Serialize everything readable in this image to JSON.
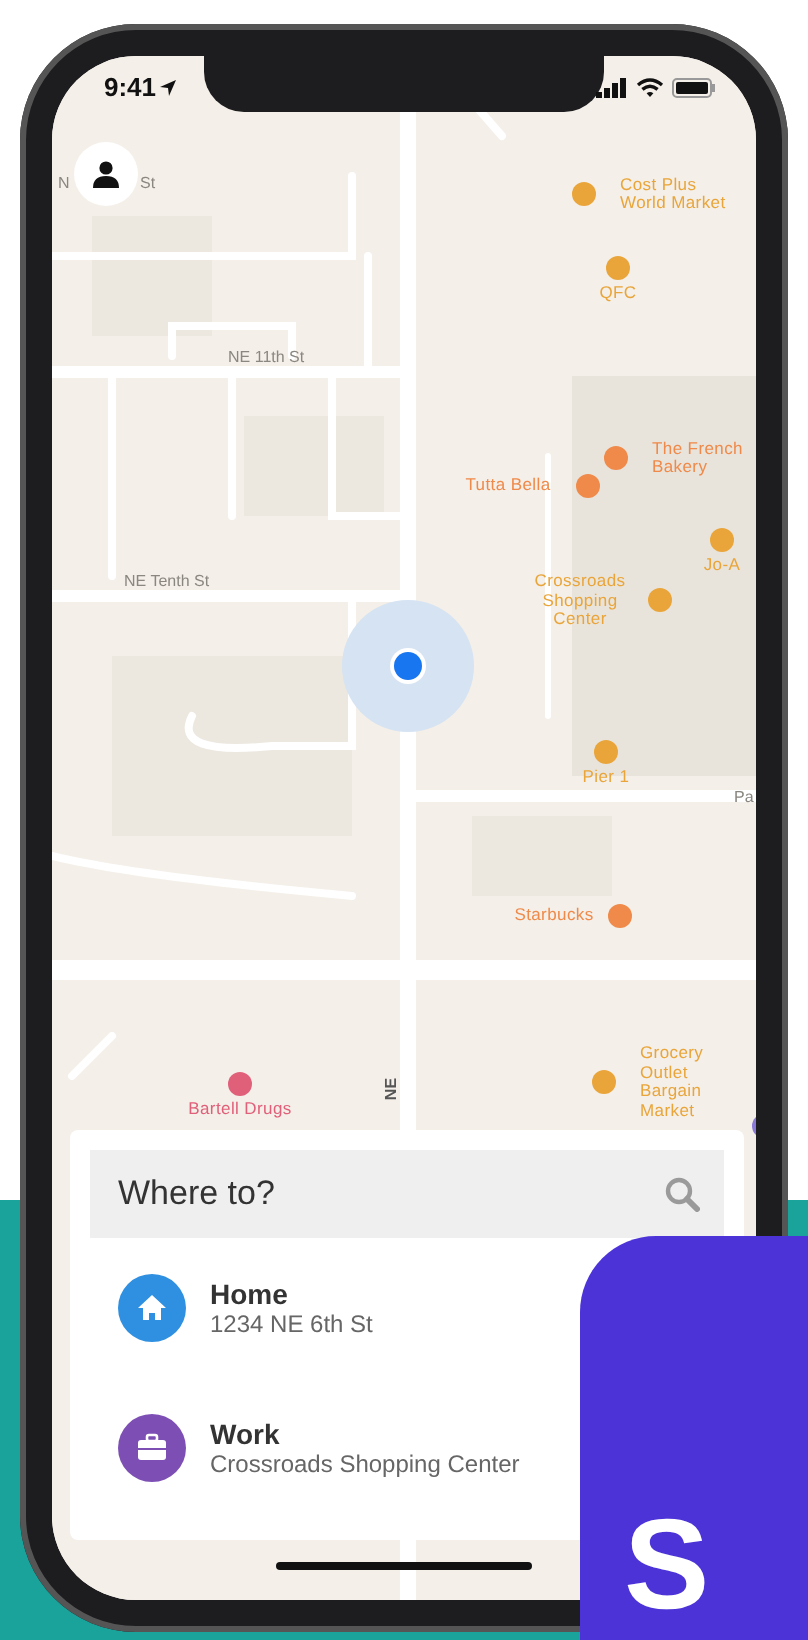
{
  "status_bar": {
    "time": "9:41"
  },
  "map": {
    "street_labels": [
      {
        "text": "N"
      },
      {
        "text": "St"
      },
      {
        "text": "NE 11th St"
      },
      {
        "text": "NE Tenth St"
      },
      {
        "text": "Pa"
      },
      {
        "text": "NE",
        "kind": "vertical"
      }
    ],
    "places": [
      {
        "name": "Cost Plus World Market",
        "color": "#e9a53a"
      },
      {
        "name": "QFC",
        "color": "#e9a53a"
      },
      {
        "name": "The French Bakery",
        "color": "#ef8a4a"
      },
      {
        "name": "Tutta Bella",
        "color": "#ef8a4a"
      },
      {
        "name": "Jo-A",
        "color": "#e9a53a"
      },
      {
        "name": "Crossroads Shopping Center",
        "color": "#e9a53a"
      },
      {
        "name": "Pier 1",
        "color": "#e9a53a"
      },
      {
        "name": "Starbucks",
        "color": "#ef8a4a"
      },
      {
        "name": "Bartell Drugs",
        "color": "#e0607a"
      },
      {
        "name": "Grocery Outlet Bargain Market",
        "color": "#e9a53a"
      },
      {
        "color": "#8a7ad8"
      }
    ]
  },
  "search": {
    "placeholder": "Where to?"
  },
  "saved_places": [
    {
      "kind": "home",
      "title": "Home",
      "address": "1234 NE 6th St"
    },
    {
      "kind": "work",
      "title": "Work",
      "address": "Crossroads Shopping Center"
    }
  ],
  "app_tile": {
    "text": "S"
  }
}
